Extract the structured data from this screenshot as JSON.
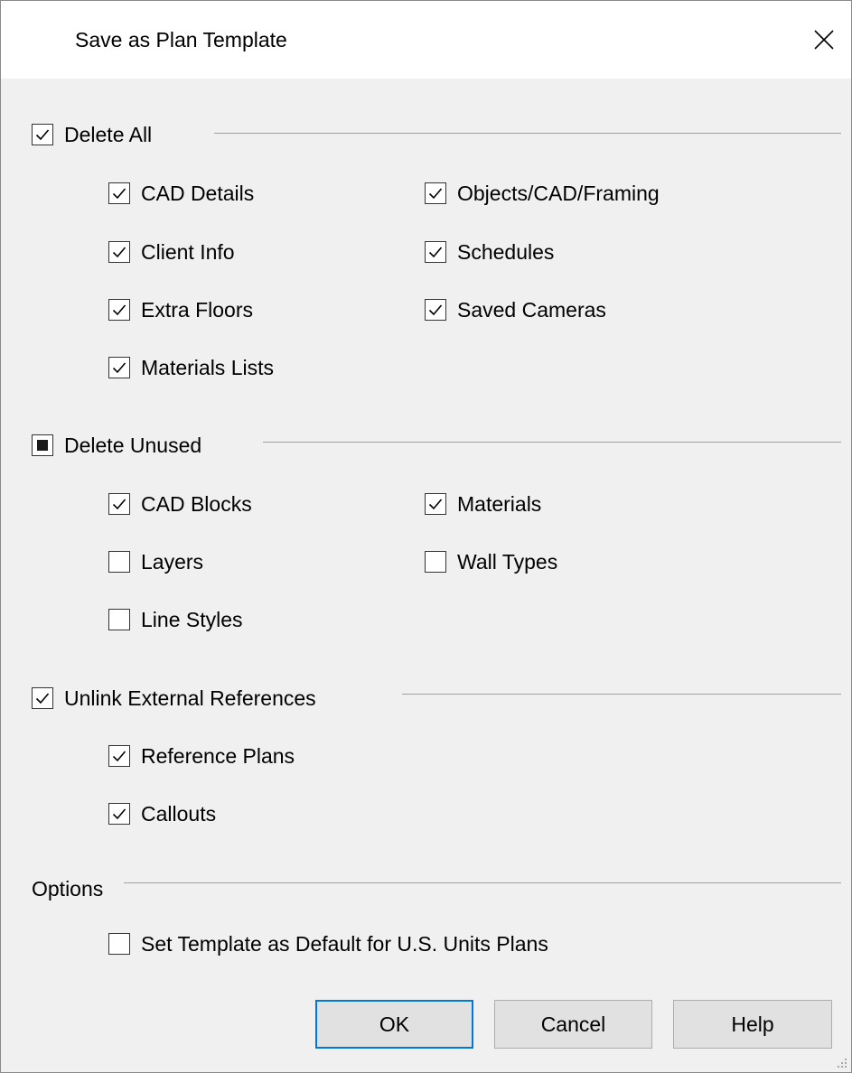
{
  "window": {
    "title": "Save as Plan Template"
  },
  "delete_all": {
    "label": "Delete All",
    "state": "checked",
    "items": [
      {
        "label": "CAD Details",
        "checked": true
      },
      {
        "label": "Client Info",
        "checked": true
      },
      {
        "label": "Extra Floors",
        "checked": true
      },
      {
        "label": "Materials Lists",
        "checked": true
      },
      {
        "label": "Objects/CAD/Framing",
        "checked": true
      },
      {
        "label": "Schedules",
        "checked": true
      },
      {
        "label": "Saved Cameras",
        "checked": true
      }
    ]
  },
  "delete_unused": {
    "label": "Delete Unused",
    "state": "indeterminate",
    "items": [
      {
        "label": "CAD Blocks",
        "checked": true
      },
      {
        "label": "Layers",
        "checked": false
      },
      {
        "label": "Line Styles",
        "checked": false
      },
      {
        "label": "Materials",
        "checked": true
      },
      {
        "label": "Wall Types",
        "checked": false
      }
    ]
  },
  "unlink": {
    "label": "Unlink External References",
    "state": "checked",
    "items": [
      {
        "label": "Reference Plans",
        "checked": true
      },
      {
        "label": "Callouts",
        "checked": true
      }
    ]
  },
  "options": {
    "label": "Options",
    "default_template": {
      "label": "Set Template as Default for U.S. Units Plans",
      "checked": false
    }
  },
  "buttons": {
    "ok": "OK",
    "cancel": "Cancel",
    "help": "Help"
  },
  "icons": {
    "close": "close-icon",
    "check": "check-icon",
    "grip": "resize-grip-icon"
  }
}
